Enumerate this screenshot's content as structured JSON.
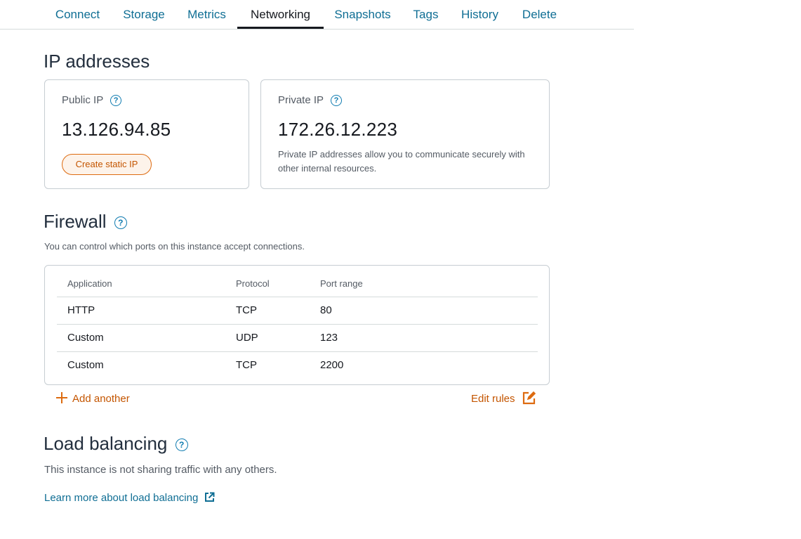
{
  "tabs": [
    {
      "label": "Connect"
    },
    {
      "label": "Storage"
    },
    {
      "label": "Metrics"
    },
    {
      "label": "Networking",
      "active": true
    },
    {
      "label": "Snapshots"
    },
    {
      "label": "Tags"
    },
    {
      "label": "History"
    },
    {
      "label": "Delete"
    }
  ],
  "ip_section": {
    "title": "IP addresses",
    "public": {
      "label": "Public IP",
      "value": "13.126.94.85",
      "button": "Create static IP"
    },
    "private": {
      "label": "Private IP",
      "value": "172.26.12.223",
      "note": "Private IP addresses allow you to communicate securely with other internal resources."
    }
  },
  "firewall": {
    "title": "Firewall",
    "description": "You can control which ports on this instance accept connections.",
    "columns": [
      "Application",
      "Protocol",
      "Port range"
    ],
    "rows": [
      {
        "application": "HTTP",
        "protocol": "TCP",
        "port": "80"
      },
      {
        "application": "Custom",
        "protocol": "UDP",
        "port": "123"
      },
      {
        "application": "Custom",
        "protocol": "TCP",
        "port": "2200"
      }
    ],
    "add_label": "Add another",
    "edit_label": "Edit rules"
  },
  "load_balancing": {
    "title": "Load balancing",
    "description": "This instance is not sharing traffic with any others.",
    "learn_more": "Learn more about load balancing"
  },
  "colors": {
    "link": "#0f6e94",
    "accent_orange": "#dd6b10",
    "text_dark": "#16191f"
  },
  "icons": {
    "help": "help-circle-icon",
    "add": "plus-icon",
    "edit": "edit-icon",
    "external": "external-link-icon"
  }
}
